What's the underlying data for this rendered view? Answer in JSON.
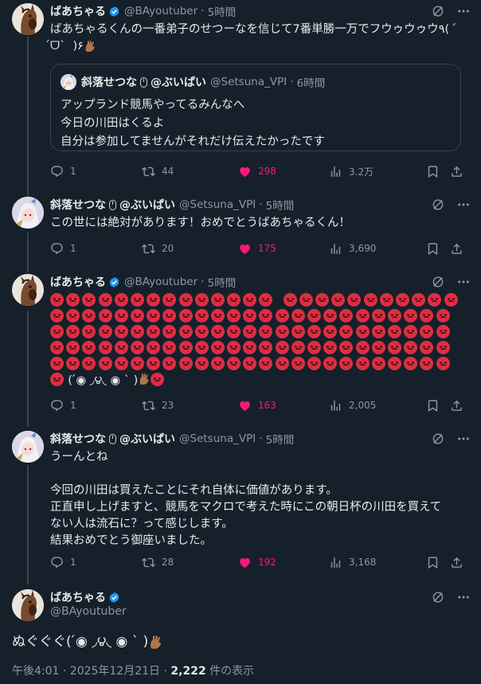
{
  "tweets": [
    {
      "name": "ばあちゃる",
      "handle": "@BAyoutuber",
      "time": "5時間",
      "body": "ばあちゃるくんの一番弟子のせつーなを信じて7番単勝一万でフウゥウゥウ٩(  ́ᗜ`  )۶",
      "quote": {
        "name": "斜落せつな",
        "name_suffix": "@ぶいぱい",
        "handle": "@Setsuna_VPI",
        "time": "6時間",
        "body": "アップランド競馬やってるみんなへ\n今日の川田はくるよ\n自分は参加してませんがそれだけ伝えたかったです"
      },
      "stats": {
        "replies": "1",
        "retweets": "44",
        "likes": "298",
        "views": "3.2万"
      }
    },
    {
      "name": "斜落せつな",
      "name_suffix": "@ぶいぱい",
      "handle": "@Setsuna_VPI",
      "time": "5時間",
      "body": "この世には絶対があります！おめでとうばあちゃるくん！",
      "stats": {
        "replies": "1",
        "retweets": "20",
        "likes": "175",
        "views": "3,690"
      }
    },
    {
      "name": "ばあちゃる",
      "handle": "@BAyoutuber",
      "time": "5時間",
      "emoji_tail": "(  ́◉ ◞౪◟ ◉ ` )",
      "stats": {
        "replies": "1",
        "retweets": "23",
        "likes": "163",
        "views": "2,005"
      }
    },
    {
      "name": "斜落せつな",
      "name_suffix": "@ぶいぱい",
      "handle": "@Setsuna_VPI",
      "time": "5時間",
      "body": "うーんとね\n\n今回の川田は買えたことにそれ自体に価値があります。\n正直申し上げますと、競馬をマクロで考えた時にこの朝日杯の川田を買えて\nない人は流石に？って感じします。\n結果おめでとう御座いました。",
      "stats": {
        "replies": "1",
        "retweets": "28",
        "likes": "192",
        "views": "3,168"
      }
    }
  ],
  "main": {
    "name": "ばあちゃる",
    "handle": "@BAyoutuber",
    "body": "ぬぐぐぐ(  ́◉ ◞౪◟ ◉ ` )",
    "posted": "午後4:01 · 2025年12月21日 ·",
    "views_count": "2,222",
    "views_label": "件の表示"
  },
  "icons": [
    "grok-icon",
    "more-icon",
    "reply-icon",
    "retweet-icon",
    "like-icon",
    "views-icon",
    "bookmark-icon",
    "share-icon",
    "verified-icon",
    "mouse-icon",
    "angry-face-icon",
    "horse-avatar",
    "anime-girl-avatar"
  ],
  "colors": {
    "background": "#15202b",
    "text": "#e7e9ea",
    "muted": "#8b98a5",
    "like": "#f91880",
    "verified": "#1d9bf0",
    "border": "#38444d"
  }
}
